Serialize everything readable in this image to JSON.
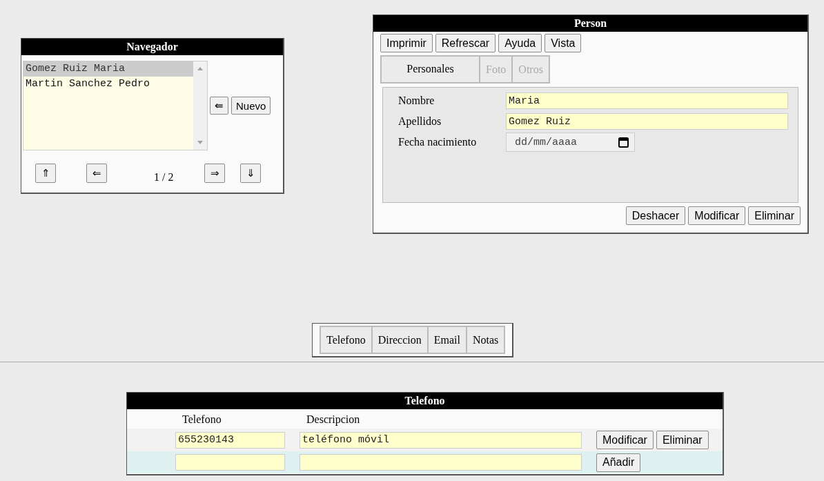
{
  "navigator": {
    "title": "Navegador",
    "items": [
      {
        "label": "Gomez Ruiz Maria",
        "selected": true
      },
      {
        "label": "Martin Sanchez Pedro",
        "selected": false
      }
    ],
    "side_buttons": [
      "⇚",
      "Nuevo"
    ],
    "nav_buttons": [
      "⇑",
      "⇐",
      "⇒",
      "⇓"
    ],
    "page": "1 / 2"
  },
  "person": {
    "title": "Person",
    "toolbar": [
      "Imprimir",
      "Refrescar",
      "Ayuda",
      "Vista"
    ],
    "tabs": [
      {
        "label": "Personales",
        "selected": true,
        "disabled": false
      },
      {
        "label": "Foto",
        "selected": false,
        "disabled": true
      },
      {
        "label": "Otros",
        "selected": false,
        "disabled": true
      }
    ],
    "fields": [
      {
        "kind": "text",
        "label": "Nombre",
        "value": "Maria"
      },
      {
        "kind": "text",
        "label": "Apellidos",
        "value": "Gomez Ruiz"
      },
      {
        "kind": "date",
        "label": "Fecha nacimiento",
        "placeholder": "dd/mm/aaaa"
      }
    ],
    "buttons": [
      "Deshacer",
      "Modificar",
      "Eliminar"
    ]
  },
  "detail_tabs": [
    "Telefono",
    "Direccion",
    "Email",
    "Notas"
  ],
  "telefono": {
    "title": "Telefono",
    "columns": [
      "Telefono",
      "Descripcion"
    ],
    "rows": [
      {
        "kind": "existing",
        "telefono": "655230143",
        "descripcion": "teléfono móvil",
        "buttons": [
          "Modificar",
          "Eliminar"
        ]
      },
      {
        "kind": "new",
        "buttons": [
          "Añadir"
        ]
      }
    ]
  }
}
